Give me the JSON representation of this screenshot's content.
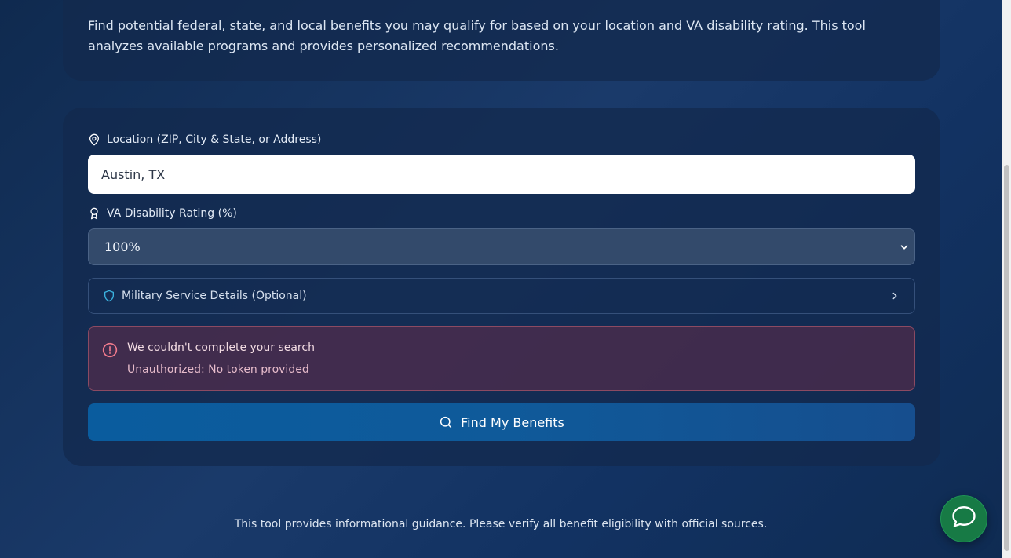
{
  "intro": {
    "description": "Find potential federal, state, and local benefits you may qualify for based on your location and VA disability rating. This tool analyzes available programs and provides personalized recommendations."
  },
  "form": {
    "location_label": "Location (ZIP, City & State, or Address)",
    "location_value": "Austin, TX",
    "rating_label": "VA Disability Rating (%)",
    "rating_selected": "100%",
    "service_details_label": "Military Service Details (Optional)",
    "error_title": "We couldn't complete your search",
    "error_message": "Unauthorized: No token provided",
    "submit_label": "Find My Benefits"
  },
  "footer": {
    "note": "This tool provides informational guidance. Please verify all benefit eligibility with official sources."
  },
  "icons": {
    "location": "map-pin-icon",
    "rating": "award-icon",
    "service": "shield-icon",
    "error": "alert-circle-icon",
    "submit": "search-icon",
    "chat": "chat-bubble-icon"
  },
  "colors": {
    "accent": "#0a5c9e",
    "error_bg": "#782c46",
    "chat": "#177a45",
    "shield": "#3bb3e0"
  }
}
